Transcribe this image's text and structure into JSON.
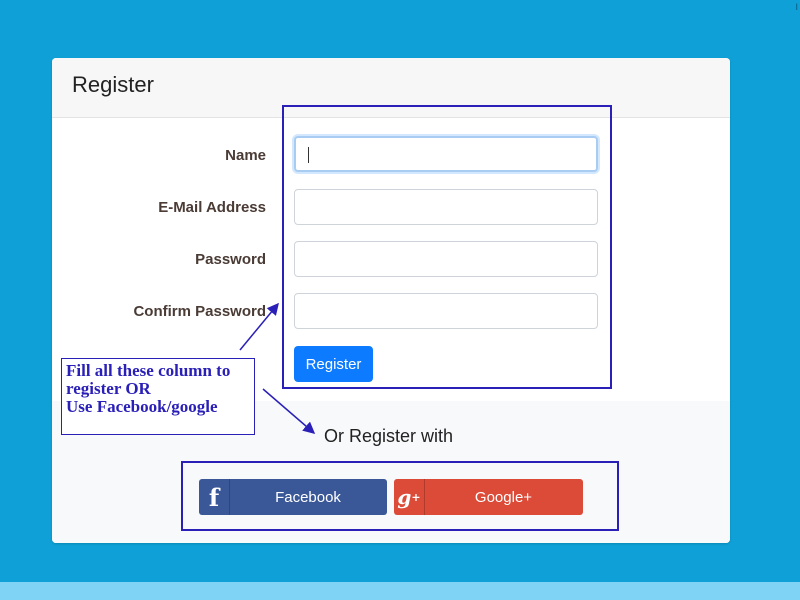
{
  "corner_mark": "I",
  "card": {
    "title": "Register"
  },
  "form": {
    "fields": [
      {
        "label": "Name",
        "value": "",
        "placeholder": "",
        "focused": true
      },
      {
        "label": "E-Mail Address",
        "value": "",
        "placeholder": ""
      },
      {
        "label": "Password",
        "value": "",
        "placeholder": ""
      },
      {
        "label": "Confirm Password",
        "value": "",
        "placeholder": ""
      }
    ],
    "submit_label": "Register"
  },
  "social": {
    "or_text": "Or Register with",
    "facebook": {
      "icon": "facebook-icon",
      "glyph": "f",
      "label": "Facebook",
      "color": "#3a5898"
    },
    "google": {
      "icon": "google-plus-icon",
      "glyph": "g",
      "glyph_sup": "+",
      "label": "Google+",
      "color": "#dc4a38"
    }
  },
  "annotation": {
    "lines": [
      "Fill all these column to",
      "register OR",
      "Use Facebook/google"
    ],
    "color": "#2a20b8"
  },
  "colors": {
    "page_background": "#0ea0d6",
    "primary_button": "#0d7bff"
  }
}
